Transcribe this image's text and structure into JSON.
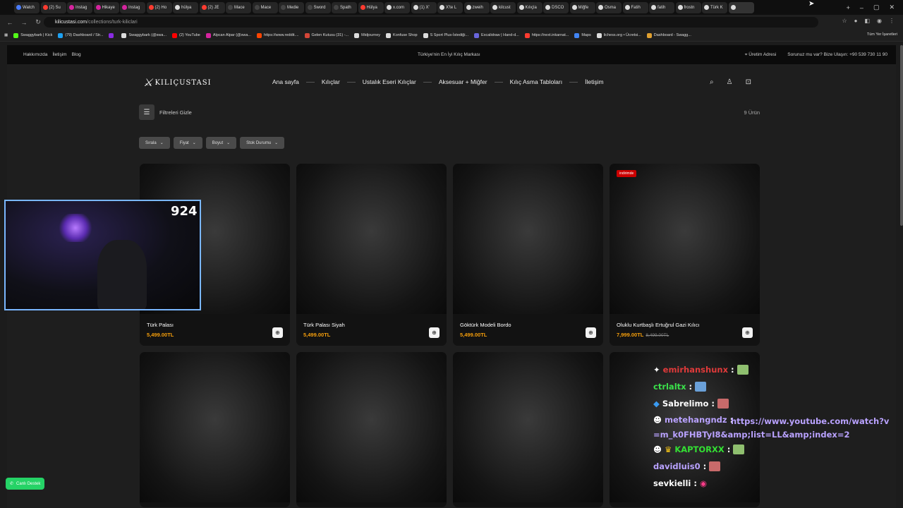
{
  "browser": {
    "tabs": [
      "Watch",
      "(2) Su",
      "Instag",
      "Hikaye",
      "Instag",
      "(2) Ho",
      "hülya",
      "(2) JE",
      "Mace",
      "Mace",
      "Medie",
      "Sword",
      "Spath",
      "Hülya",
      "x.com",
      "(1) X'",
      "X'te L",
      "zweih",
      "kilcust",
      "Kılıçla",
      "DSCO",
      "Miğfe",
      "Osma",
      "Fatih",
      "fatih",
      "frostn",
      "Türk K",
      ""
    ],
    "url_host": "kilicustasi.com",
    "url_path": "/collections/turk-kiliclari",
    "bookmarks": [
      "Swaggybark | Kick",
      "(79) Dashboard / Str...",
      "",
      "Swaggybark (@swa...",
      "(2) YouTube",
      "Alpcan Alpar (@swa...",
      "https://www.reddit....",
      "Gelen Kutusu (31) -...",
      "Midjourney",
      "Konfuse Shop",
      "S Sport Plus-İstediği...",
      "Excalidraw | Hand-d...",
      "https://next.inkarnat...",
      "Maps",
      "lichess.org • Ücretsi...",
      "Dashboard - Swagg..."
    ],
    "bookmarks_all": "Tüm Yer İşaretleri"
  },
  "topbar": {
    "links": [
      "Hakkımızda",
      "İletişim",
      "Blog"
    ],
    "tagline": "Türkiye'nin En İyi Kılıç Markası",
    "address": "Üretim Adresi",
    "contact": "Sorunuz mu var? Bize Ulaşın: +90 539 730 11 90"
  },
  "header": {
    "logo": "KILIÇUSTASI",
    "nav": [
      "Ana sayfa",
      "Kılıçlar",
      "Ustalık Eseri Kılıçlar",
      "Aksesuar + Miğfer",
      "Kılıç Asma Tabloları",
      "İletişim"
    ]
  },
  "filters": {
    "toggle_label": "Filtreleri Gizle",
    "count": "9 Ürün",
    "chips": [
      "Sırala",
      "Fiyat",
      "Boyut",
      "Stok Durumu"
    ]
  },
  "products": [
    {
      "name": "Türk Palası",
      "price": "5,499.00TL",
      "old_price": "",
      "badge": ""
    },
    {
      "name": "Türk Palası Siyah",
      "price": "5,499.00TL",
      "old_price": "",
      "badge": ""
    },
    {
      "name": "Göktürk Modeli Bordo",
      "price": "5,499.00TL",
      "old_price": "",
      "badge": ""
    },
    {
      "name": "Oluklu Kurtbaşlı Ertuğrul Gazi Kılıcı",
      "price": "7,999.00TL",
      "old_price": "8,499.00TL",
      "badge": "indirimde"
    },
    {
      "name": "",
      "price": "",
      "old_price": "",
      "badge": ""
    },
    {
      "name": "",
      "price": "",
      "old_price": "",
      "badge": ""
    },
    {
      "name": "",
      "price": "",
      "old_price": "",
      "badge": ""
    },
    {
      "name": "",
      "price": "",
      "old_price": "",
      "badge": ""
    }
  ],
  "overlay": {
    "counter": "924",
    "chat": [
      {
        "user": "emirhanshunx",
        "msg": "",
        "color": "#e03a3a"
      },
      {
        "user": "ctrlaltx",
        "msg": "",
        "color": "#3ae04a"
      },
      {
        "user": "Sabrelimo",
        "msg": "",
        "color": "#ffffff"
      },
      {
        "user": "metehangndz",
        "msg": "https://www.youtube.com/watch?v=m_k0FHBTyI8&amp;list=LL&amp;index=2",
        "color": "#b9a2ff"
      },
      {
        "user": "KAPTORXX",
        "msg": "",
        "color": "#33e033"
      },
      {
        "user": "davidluis0",
        "msg": "",
        "color": "#b9a2ff"
      },
      {
        "user": "sevkielli",
        "msg": "",
        "color": "#ffffff"
      }
    ],
    "support": "Canlı Destek"
  }
}
